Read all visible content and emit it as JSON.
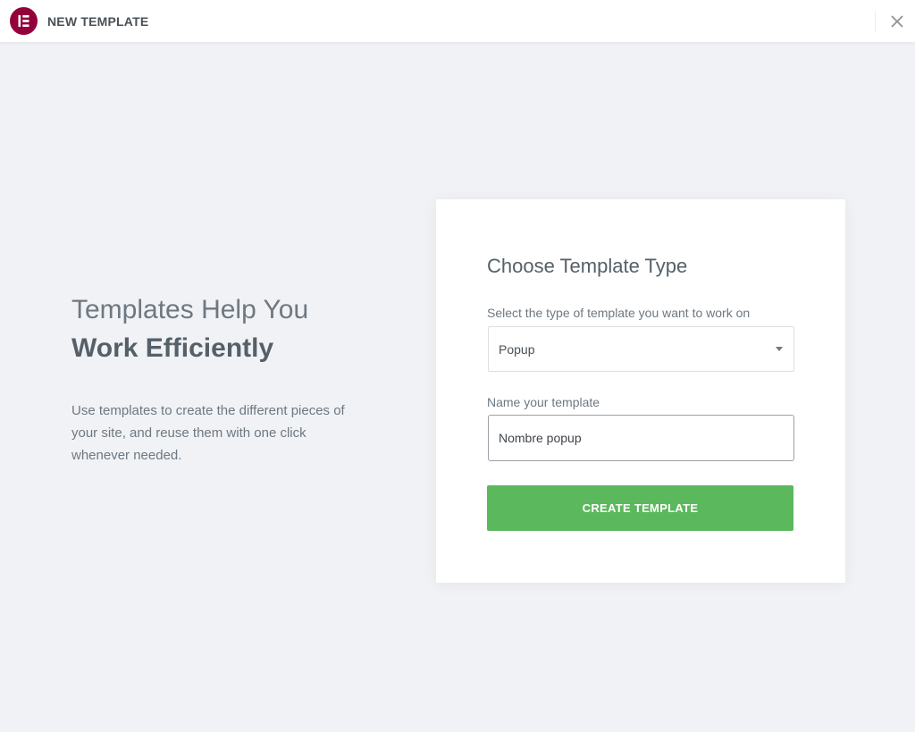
{
  "header": {
    "title": "NEW TEMPLATE",
    "logo_icon": "elementor-logo-icon",
    "close_icon": "close-icon",
    "brand_color": "#93003c"
  },
  "intro": {
    "heading_line1": "Templates Help You",
    "heading_line2": "Work Efficiently",
    "description": "Use templates to create the different pieces of your site, and reuse them with one click whenever needed."
  },
  "form": {
    "title": "Choose Template Type",
    "type_label": "Select the type of template you want to work on",
    "type_selected": "Popup",
    "name_label": "Name your template",
    "name_value": "Nombre popup",
    "submit_label": "CREATE TEMPLATE",
    "submit_color": "#5cb85c"
  }
}
